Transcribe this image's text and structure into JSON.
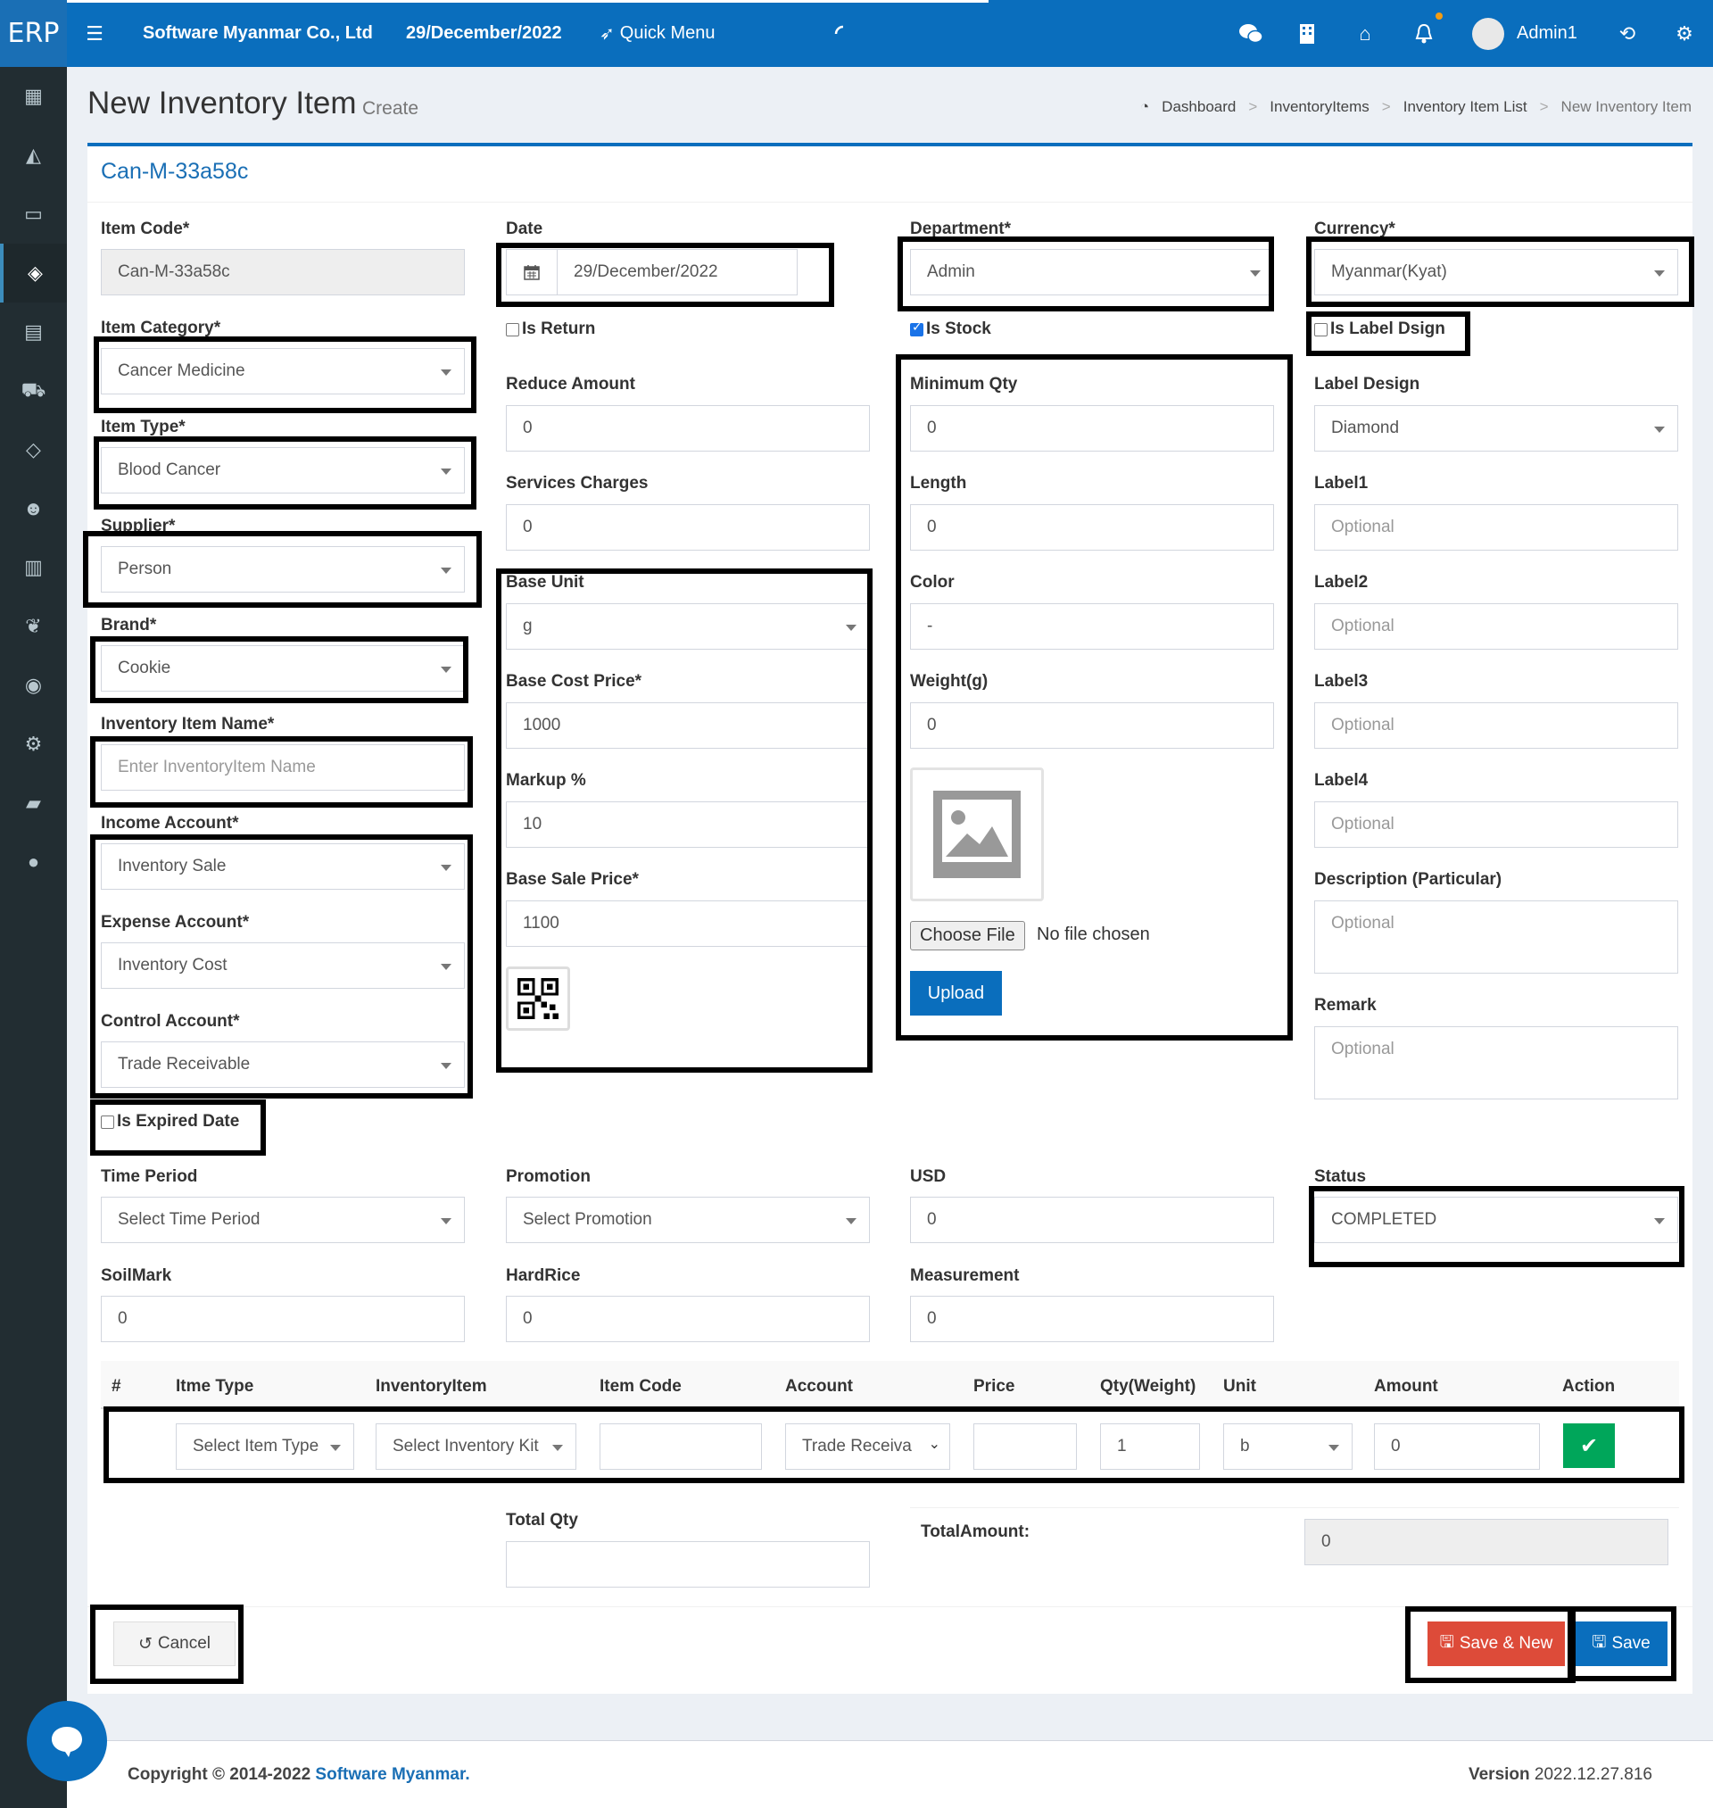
{
  "topbar": {
    "logo": "ERP",
    "company": "Software Myanmar Co., Ltd",
    "date": "29/December/2022",
    "quick_menu": "Quick Menu",
    "user": "Admin1"
  },
  "header": {
    "title": "New Inventory Item",
    "subtitle": "Create",
    "breadcrumb": [
      "Dashboard",
      "InventoryItems",
      "Inventory Item List",
      "New Inventory Item"
    ]
  },
  "form": {
    "box_title": "Can-M-33a58c",
    "item_code": {
      "label": "Item Code*",
      "value": "Can-M-33a58c"
    },
    "item_category": {
      "label": "Item Category*",
      "value": "Cancer Medicine"
    },
    "item_type": {
      "label": "Item Type*",
      "value": "Blood Cancer"
    },
    "supplier": {
      "label": "Supplier*",
      "value": "Person"
    },
    "brand": {
      "label": "Brand*",
      "value": "Cookie"
    },
    "item_name": {
      "label": "Inventory Item Name*",
      "placeholder": "Enter InventoryItem Name"
    },
    "income_account": {
      "label": "Income Account*",
      "value": "Inventory Sale"
    },
    "expense_account": {
      "label": "Expense Account*",
      "value": "Inventory Cost"
    },
    "control_account": {
      "label": "Control Account*",
      "value": "Trade Receivable"
    },
    "is_expired": {
      "label": "Is Expired Date",
      "checked": false
    },
    "date": {
      "label": "Date",
      "value": "29/December/2022"
    },
    "is_return": {
      "label": "Is Return",
      "checked": false
    },
    "reduce_amount": {
      "label": "Reduce Amount",
      "value": "0"
    },
    "services_charges": {
      "label": "Services Charges",
      "value": "0"
    },
    "base_unit": {
      "label": "Base Unit",
      "value": "g"
    },
    "base_cost": {
      "label": "Base Cost Price*",
      "value": "1000"
    },
    "markup": {
      "label": "Markup %",
      "value": "10"
    },
    "base_sale": {
      "label": "Base Sale Price*",
      "value": "1100"
    },
    "department": {
      "label": "Department*",
      "value": "Admin"
    },
    "is_stock": {
      "label": "Is Stock",
      "checked": true
    },
    "min_qty": {
      "label": "Minimum Qty",
      "value": "0"
    },
    "length": {
      "label": "Length",
      "value": "0"
    },
    "color": {
      "label": "Color",
      "value": "-"
    },
    "weight": {
      "label": "Weight(g)",
      "value": "0"
    },
    "choose_file": "Choose File",
    "no_file": "No file chosen",
    "upload": "Upload",
    "currency": {
      "label": "Currency*",
      "value": "Myanmar(Kyat)"
    },
    "is_label_design": {
      "label": "Is Label Dsign",
      "checked": false
    },
    "label_design": {
      "label": "Label Design",
      "value": "Diamond"
    },
    "label1": {
      "label": "Label1",
      "placeholder": "Optional"
    },
    "label2": {
      "label": "Label2",
      "placeholder": "Optional"
    },
    "label3": {
      "label": "Label3",
      "placeholder": "Optional"
    },
    "label4": {
      "label": "Label4",
      "placeholder": "Optional"
    },
    "description": {
      "label": "Description (Particular)",
      "placeholder": "Optional"
    },
    "remark": {
      "label": "Remark",
      "placeholder": "Optional"
    },
    "time_period": {
      "label": "Time Period",
      "value": "Select Time Period"
    },
    "promotion": {
      "label": "Promotion",
      "value": "Select Promotion"
    },
    "usd": {
      "label": "USD",
      "value": "0"
    },
    "status": {
      "label": "Status",
      "value": "COMPLETED"
    },
    "soilmark": {
      "label": "SoilMark",
      "value": "0"
    },
    "hardrice": {
      "label": "HardRice",
      "value": "0"
    },
    "measurement": {
      "label": "Measurement",
      "value": "0"
    }
  },
  "table": {
    "headers": [
      "#",
      "Itme Type",
      "InventoryItem",
      "Item Code",
      "Account",
      "Price",
      "Qty(Weight)",
      "Unit",
      "Amount",
      "Action"
    ],
    "row": {
      "item_type": "Select Item Type",
      "inventory_item": "Select Inventory Kit",
      "item_code": "",
      "account": "Trade Receiva",
      "price": "",
      "qty": "1",
      "unit": "b",
      "amount": "0"
    }
  },
  "totals": {
    "total_qty_label": "Total Qty",
    "total_qty_value": "",
    "total_amount_label": "TotalAmount:",
    "total_amount_value": "0"
  },
  "buttons": {
    "cancel": "Cancel",
    "save_new": "Save & New",
    "save": "Save"
  },
  "footer": {
    "copyright": "Copyright © 2014-2022",
    "brand": "Software Myanmar.",
    "version_label": "Version",
    "version": "2022.12.27.816"
  },
  "colors": {
    "primary": "#0a6ebd",
    "sidebar": "#222d32",
    "success": "#00a65a",
    "danger": "#dd4b39"
  }
}
